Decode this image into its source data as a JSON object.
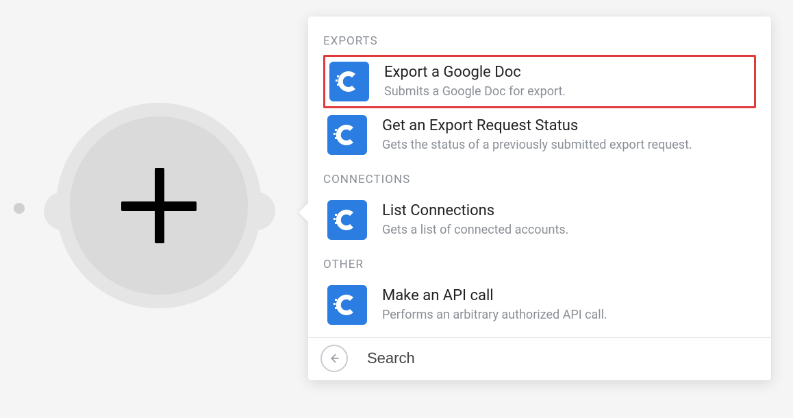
{
  "sections": {
    "exports": {
      "label": "EXPORTS",
      "items": [
        {
          "title": "Export a Google Doc",
          "desc": "Submits a Google Doc for export."
        },
        {
          "title": "Get an Export Request Status",
          "desc": "Gets the status of a previously submitted export request."
        }
      ]
    },
    "connections": {
      "label": "CONNECTIONS",
      "items": [
        {
          "title": "List Connections",
          "desc": "Gets a list of connected accounts."
        }
      ]
    },
    "other": {
      "label": "OTHER",
      "items": [
        {
          "title": "Make an API call",
          "desc": "Performs an arbitrary authorized API call."
        }
      ]
    }
  },
  "search": {
    "placeholder": "Search"
  },
  "brand": {
    "accent": "#2b7de1",
    "highlight": "#e13a3a"
  }
}
